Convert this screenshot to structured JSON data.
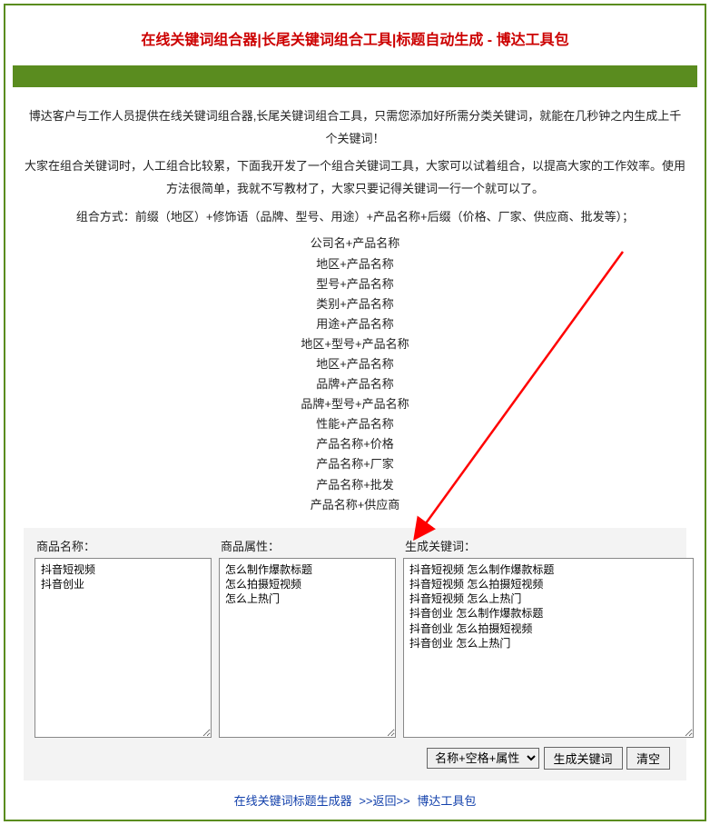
{
  "title": "在线关键词组合器|长尾关键词组合工具|标题自动生成 - 博达工具包",
  "desc": {
    "p1": "博达客户与工作人员提供在线关键词组合器,长尾关键词组合工具，只需您添加好所需分类关键词，就能在几秒钟之内生成上千个关键词！",
    "p2": "大家在组合关键词时，人工组合比较累，下面我开发了一个组合关键词工具，大家可以试着组合，以提高大家的工作效率。使用方法很简单，我就不写教材了，大家只要记得关键词一行一个就可以了。",
    "combo_intro": "组合方式：前缀（地区）+修饰语（品牌、型号、用途）+产品名称+后缀（价格、厂家、供应商、批发等）；",
    "combos": [
      "公司名+产品名称",
      "地区+产品名称",
      "型号+产品名称",
      "类别+产品名称",
      "用途+产品名称",
      "地区+型号+产品名称",
      "地区+产品名称",
      "品牌+产品名称",
      "品牌+型号+产品名称",
      "性能+产品名称",
      "产品名称+价格",
      "产品名称+厂家",
      "产品名称+批发",
      "产品名称+供应商"
    ]
  },
  "form": {
    "name_label": "商品名称：",
    "attr_label": "商品属性：",
    "result_label": "生成关键词：",
    "name_value": "抖音短视频\n抖音创业",
    "attr_value": "怎么制作爆款标题\n怎么拍摄短视频\n怎么上热门",
    "result_value": "抖音短视频 怎么制作爆款标题\n抖音短视频 怎么拍摄短视频\n抖音短视频 怎么上热门\n抖音创业 怎么制作爆款标题\n抖音创业 怎么拍摄短视频\n抖音创业 怎么上热门"
  },
  "controls": {
    "mode_selected": "名称+空格+属性",
    "generate": "生成关键词",
    "clear": "清空"
  },
  "footer": {
    "link1": "在线关键词标题生成器",
    "sep": ">>返回>>",
    "link2": "博达工具包"
  }
}
